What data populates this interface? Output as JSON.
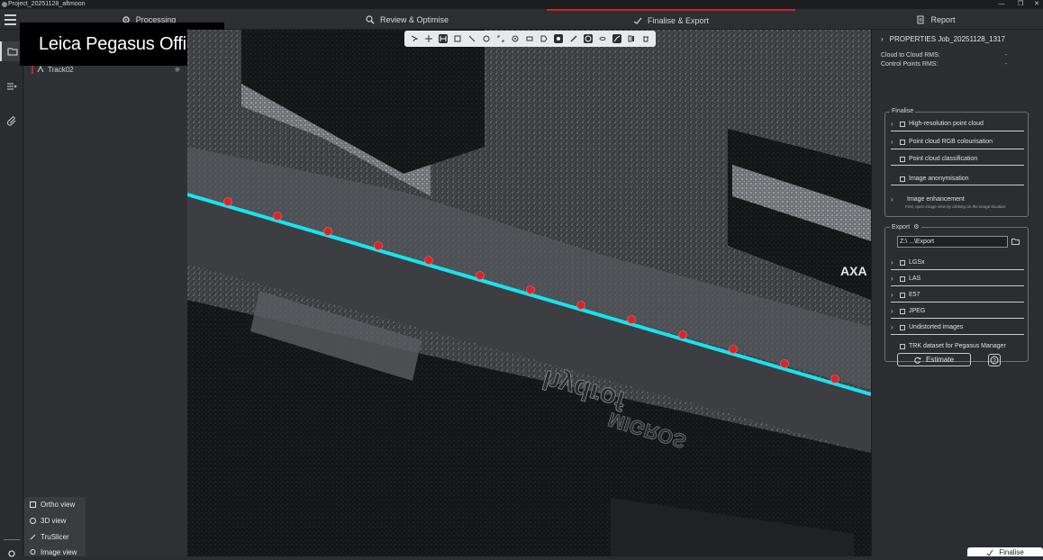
{
  "window": {
    "title": "Project_20251128_aftmoon"
  },
  "tabs": [
    {
      "label": "Processing",
      "icon": "gear-icon"
    },
    {
      "label": "Review & Optimise",
      "icon": "search-icon"
    },
    {
      "label": "Finalise & Export",
      "icon": "checkmark-icon"
    },
    {
      "label": "Report",
      "icon": "document-icon"
    }
  ],
  "banner": {
    "text": "Leica Pegasus Office"
  },
  "tree": {
    "track_label": "Track02"
  },
  "views": [
    {
      "label": "Ortho view",
      "icon": "ortho-icon"
    },
    {
      "label": "3D view",
      "icon": "cube-icon"
    },
    {
      "label": "TruSlicer",
      "icon": "slicer-icon"
    },
    {
      "label": "Image view",
      "icon": "image-icon"
    }
  ],
  "viewport": {
    "sign_text": "AXA",
    "store_text": "hydrof",
    "store_sign": "MIGROS"
  },
  "properties": {
    "title": "PROPERTIES Job_20251128_1317",
    "rows": [
      {
        "label": "Cloud to Cloud RMS:",
        "value": "-"
      },
      {
        "label": "Control Points RMS:",
        "value": "-"
      }
    ]
  },
  "finalise": {
    "legend": "Finalise",
    "options": [
      {
        "label": "High-resolution point cloud"
      },
      {
        "label": "Point cloud RGB colourisation"
      },
      {
        "label": "Point cloud classification"
      },
      {
        "label": "Image anonymisation"
      },
      {
        "label": "Image enhancement"
      }
    ],
    "hint": "First, open image view by clicking on the image location."
  },
  "export": {
    "legend": "Export",
    "path": "Z:\\ ...\\Export",
    "formats": [
      {
        "label": "LGSx"
      },
      {
        "label": "LAS"
      },
      {
        "label": "E57"
      },
      {
        "label": "JPEG"
      },
      {
        "label": "Undistorted images"
      },
      {
        "label": "TRK dataset for Pegasus Manager"
      }
    ],
    "estimate_label": "Estimate"
  },
  "finalise_button": {
    "label": "Finalise"
  },
  "colors": {
    "accent": "#c4262e",
    "trajectory": "#18e3ee",
    "control_point": "#d8252c"
  }
}
